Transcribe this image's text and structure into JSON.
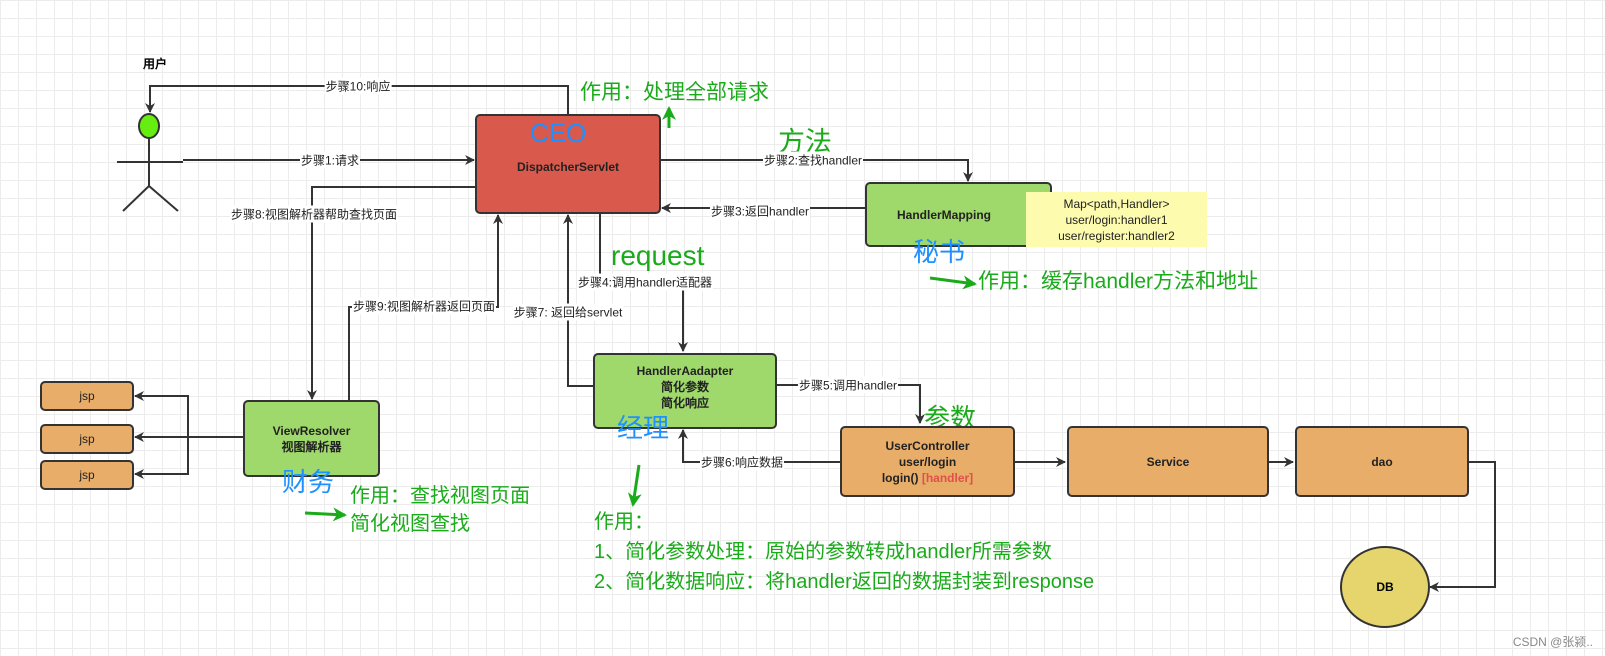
{
  "user_label": "用户",
  "dispatcher": {
    "role": "CEO",
    "name": "DispatcherServlet",
    "note": "作用：处理全部请求"
  },
  "handler_mapping": {
    "name": "HandlerMapping",
    "role": "秘书",
    "tag": "方法",
    "note_lines": [
      "Map<path,Handler>",
      "user/login:handler1",
      "user/register:handler2"
    ],
    "description": "作用：缓存handler方法和地址"
  },
  "handler_adapter": {
    "lines": [
      "HandlerAadapter",
      "简化参数",
      "简化响应"
    ],
    "role": "经理",
    "tag": "request",
    "description": [
      "作用：",
      "1、简化参数处理：原始的参数转成handler所需参数",
      "2、简化数据响应：将handler返回的数据封装到response"
    ]
  },
  "view_resolver": {
    "lines": [
      "ViewResolver",
      "视图解析器"
    ],
    "role": "财务",
    "description": [
      "作用：查找视图页面",
      "简化视图查找"
    ]
  },
  "user_controller": {
    "lines": [
      "UserController",
      "user/login",
      "login()"
    ],
    "handler_tag": "[handler]",
    "tag": "参数"
  },
  "service": "Service",
  "dao": "dao",
  "db": "DB",
  "jsp": [
    "jsp",
    "jsp",
    "jsp"
  ],
  "steps": {
    "s1": "步骤1:请求",
    "s2": "步骤2:查找handler",
    "s3": "步骤3:返回handler",
    "s4": "步骤4:调用handler适配器",
    "s5": "步骤5:调用handler",
    "s6": "步骤6:响应数据",
    "s7": "步骤7: 返回给servlet",
    "s8": "步骤8:视图解析器帮助查找页面",
    "s9": "步骤9:视图解析器返回页面",
    "s10": "步骤10:响应"
  },
  "watermark": "CSDN @张颍..",
  "colors": {
    "annotation_green": "#1aab1a",
    "role_blue": "#1e90ff",
    "dispatcher_red": "#d9594c",
    "component_green": "#9fd86b",
    "component_orange": "#e8ad69",
    "note_yellow": "#fdfbae",
    "db_yellow": "#e5d56c"
  }
}
